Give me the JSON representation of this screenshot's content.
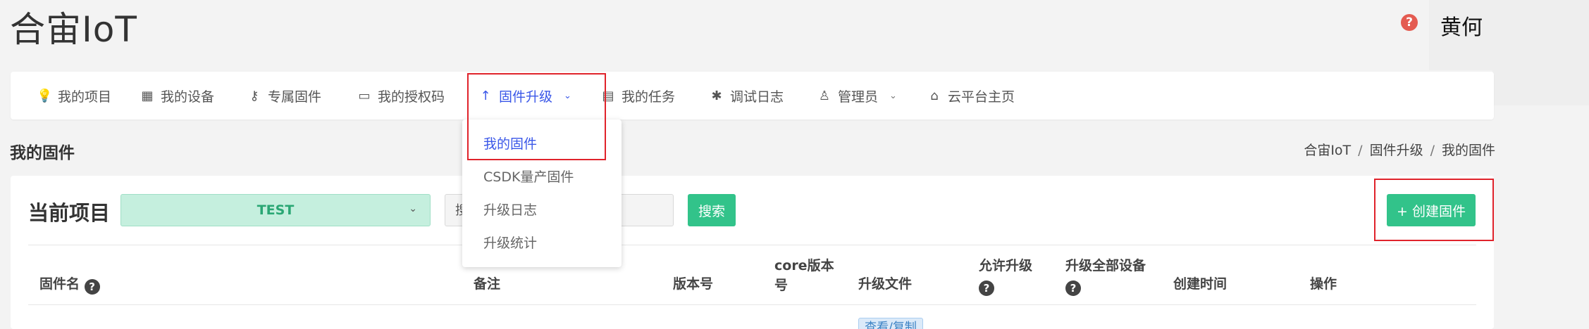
{
  "app": {
    "title": "合宙IoT"
  },
  "user": {
    "name": "黄何",
    "help_icon": "question-circle-icon",
    "help_glyph": "?"
  },
  "nav": {
    "items": [
      {
        "label": "我的项目",
        "icon": "lightbulb-icon",
        "glyph": "💡"
      },
      {
        "label": "我的设备",
        "icon": "chip-icon",
        "glyph": "▦"
      },
      {
        "label": "专属固件",
        "icon": "key-icon",
        "glyph": "⚷"
      },
      {
        "label": "我的授权码",
        "icon": "id-card-icon",
        "glyph": "▭"
      },
      {
        "label": "固件升级",
        "icon": "arrow-up-icon",
        "glyph": "↑",
        "caret": "⌄",
        "active": true
      },
      {
        "label": "我的任务",
        "icon": "calendar-icon",
        "glyph": "▤"
      },
      {
        "label": "调试日志",
        "icon": "bug-icon",
        "glyph": "✱"
      },
      {
        "label": "管理员",
        "icon": "user-icon",
        "glyph": "♙",
        "caret": "⌄"
      },
      {
        "label": "云平台主页",
        "icon": "home-icon",
        "glyph": "⌂"
      }
    ]
  },
  "dropdown": {
    "items": [
      {
        "label": "我的固件",
        "selected": true
      },
      {
        "label": "CSDK量产固件"
      },
      {
        "label": "升级日志"
      },
      {
        "label": "升级统计"
      }
    ]
  },
  "page": {
    "title": "我的固件"
  },
  "breadcrumb": {
    "items": [
      "合宙IoT",
      "固件升级",
      "我的固件"
    ],
    "separator": "/"
  },
  "toolbar": {
    "project_label": "当前项目",
    "project_value": "TEST",
    "project_caret": "⌄",
    "search_placeholder": "搜索固件名",
    "search_label": "搜索",
    "create_label": "+ 创建固件"
  },
  "table": {
    "headers": {
      "name": "固件名",
      "note": "备注",
      "version": "版本号",
      "core_version_1": "core版本",
      "core_version_2": "号",
      "upgrade_file": "升级文件",
      "allow_upgrade": "允许升级",
      "upgrade_all_devices": "升级全部设备",
      "created_time": "创建时间",
      "actions": "操作"
    },
    "help_glyph": "?",
    "row_action_partial": "查看/复制"
  },
  "colors": {
    "accent": "#3a57e8",
    "primary_button": "#32c38a",
    "select_bg": "#c5efde",
    "highlight_box": "#e0232b"
  }
}
